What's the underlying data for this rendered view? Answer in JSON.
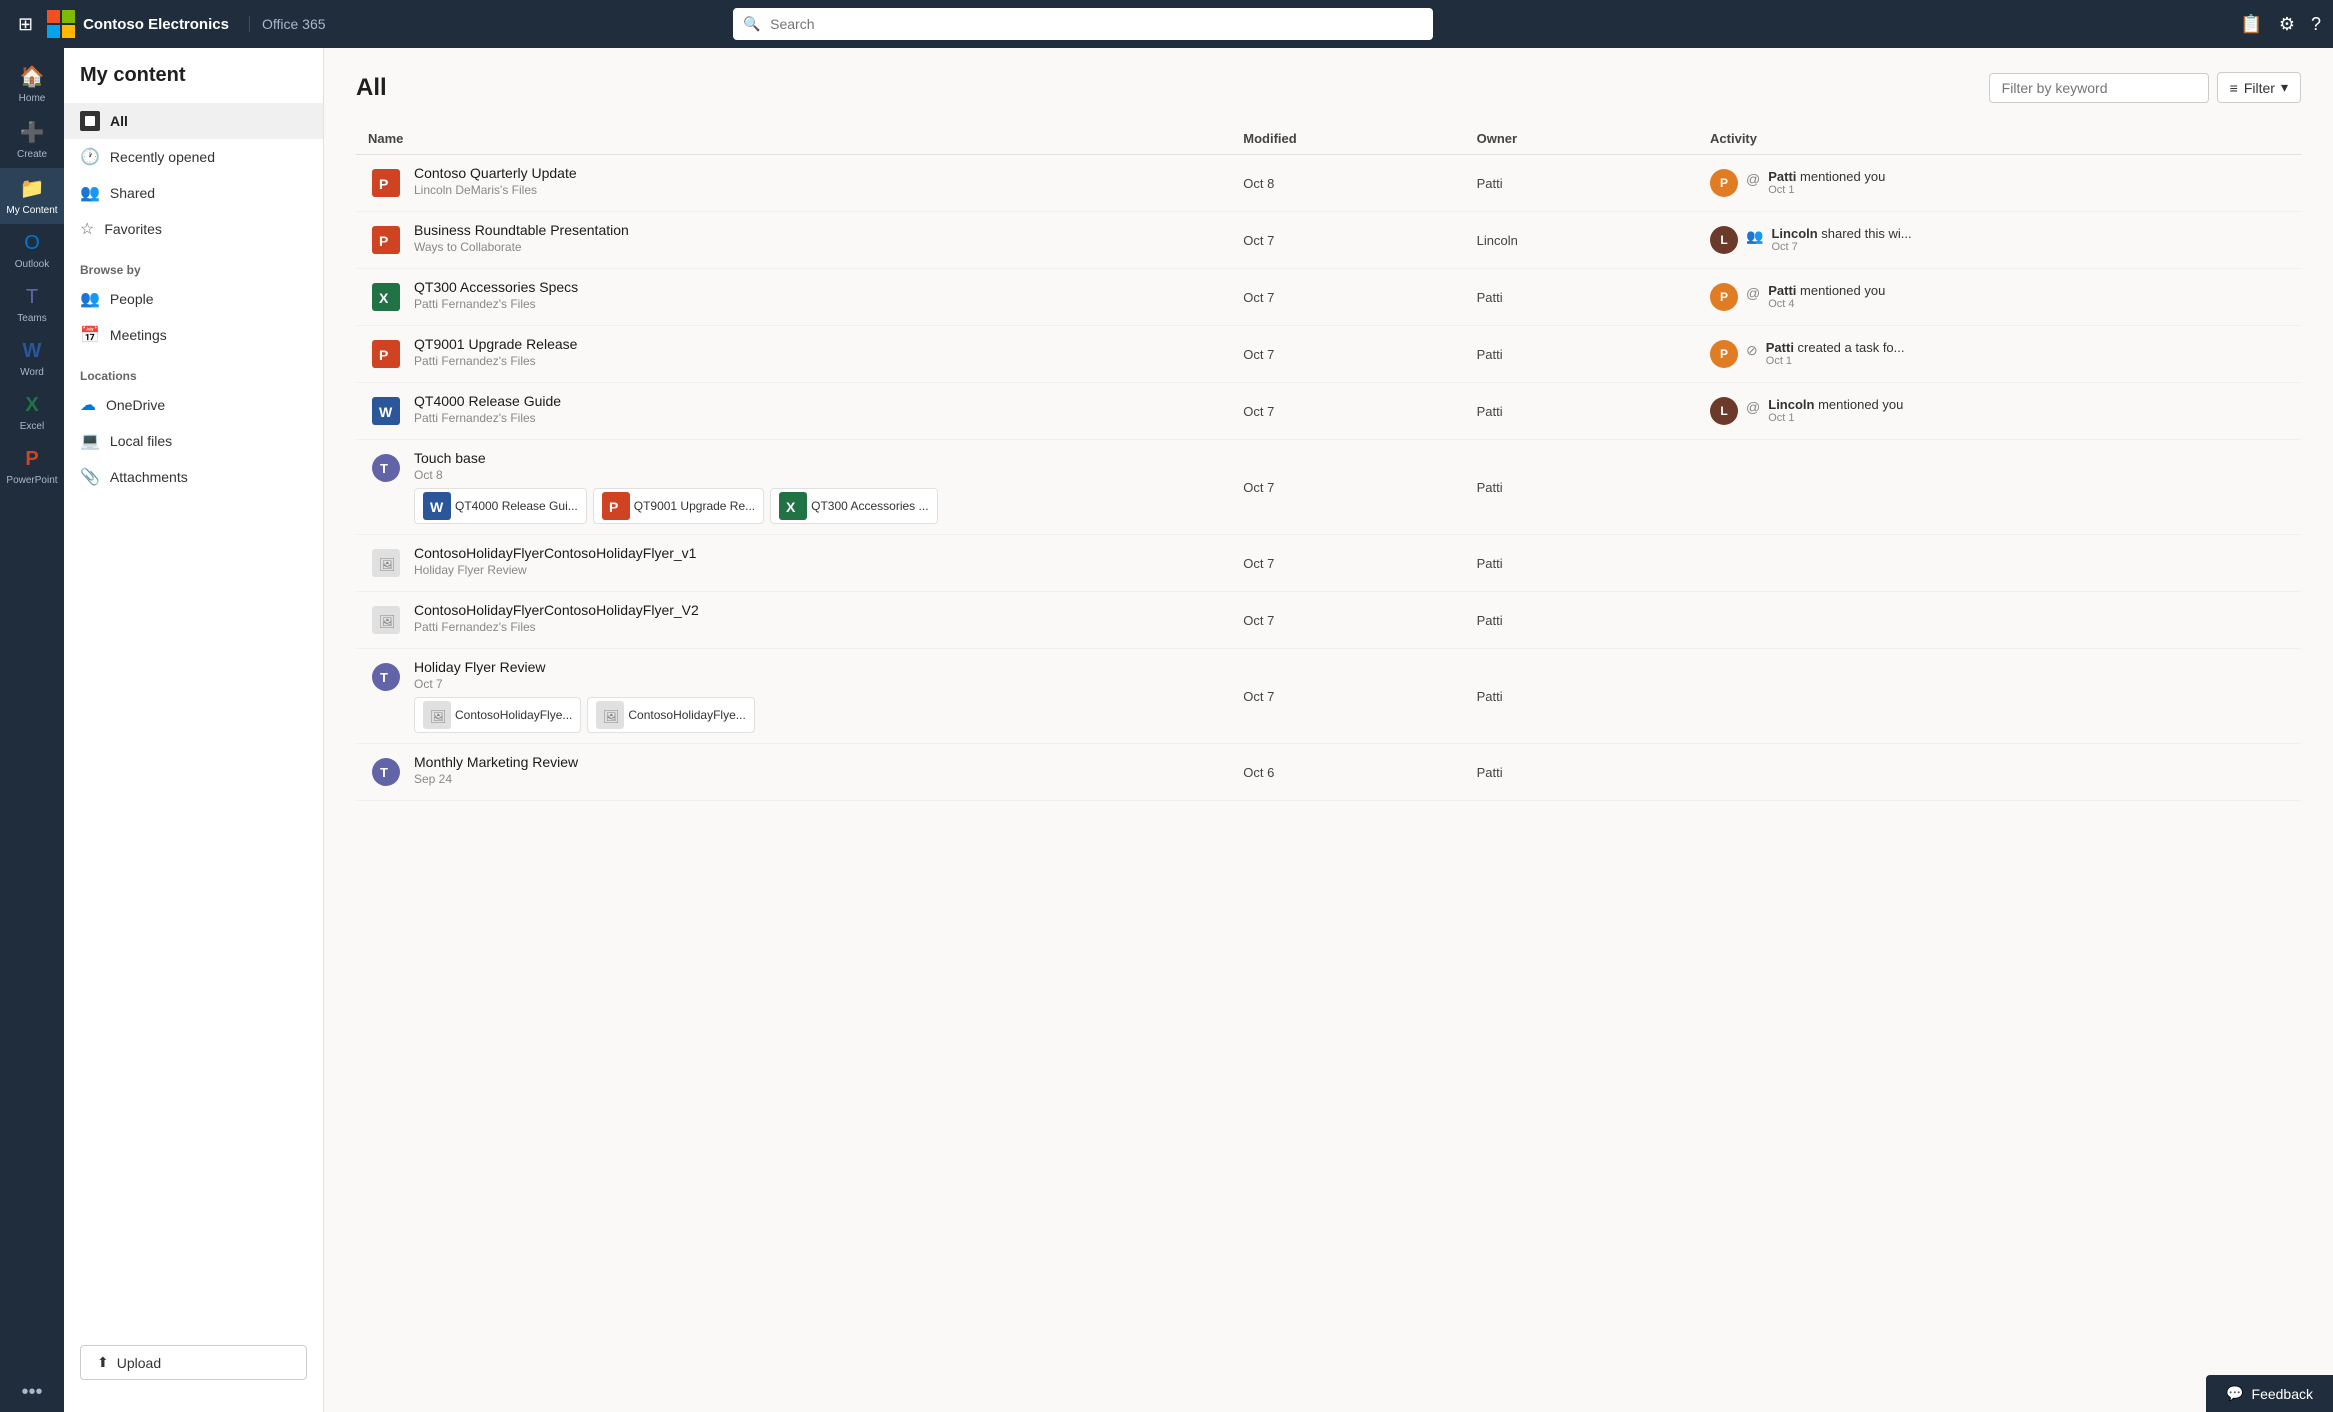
{
  "topNav": {
    "appName": "Contoso Electronics",
    "office365": "Office 365",
    "search": {
      "placeholder": "Search"
    }
  },
  "leftRail": {
    "items": [
      {
        "id": "home",
        "label": "Home",
        "icon": "🏠"
      },
      {
        "id": "create",
        "label": "Create",
        "icon": "➕"
      },
      {
        "id": "mycontent",
        "label": "My Content",
        "icon": "📁",
        "active": true
      },
      {
        "id": "outlook",
        "label": "Outlook",
        "icon": "📧",
        "color": "#0078d4"
      },
      {
        "id": "teams",
        "label": "Teams",
        "icon": "💬",
        "color": "#6264a7"
      },
      {
        "id": "word",
        "label": "Word",
        "icon": "W",
        "color": "#2b579a"
      },
      {
        "id": "excel",
        "label": "Excel",
        "icon": "X",
        "color": "#217346"
      },
      {
        "id": "powerpoint",
        "label": "PowerPoint",
        "icon": "P",
        "color": "#d04322"
      }
    ],
    "more": "..."
  },
  "sidebar": {
    "title": "My content",
    "navItems": [
      {
        "id": "all",
        "label": "All",
        "active": true,
        "type": "all"
      },
      {
        "id": "recentlyopened",
        "label": "Recently opened",
        "icon": "🕐"
      },
      {
        "id": "shared",
        "label": "Shared",
        "icon": "👥"
      },
      {
        "id": "favorites",
        "label": "Favorites",
        "icon": "☆"
      }
    ],
    "browseSectionLabel": "Browse by",
    "browseItems": [
      {
        "id": "people",
        "label": "People",
        "icon": "👥"
      },
      {
        "id": "meetings",
        "label": "Meetings",
        "icon": "📅"
      }
    ],
    "locationsSectionLabel": "Locations",
    "locationItems": [
      {
        "id": "onedrive",
        "label": "OneDrive",
        "icon": "☁"
      },
      {
        "id": "localfiles",
        "label": "Local files",
        "icon": "💻"
      },
      {
        "id": "attachments",
        "label": "Attachments",
        "icon": "📎"
      }
    ],
    "uploadLabel": "Upload"
  },
  "main": {
    "title": "All",
    "filterPlaceholder": "Filter by keyword",
    "filterLabel": "Filter",
    "columns": {
      "name": "Name",
      "modified": "Modified",
      "owner": "Owner",
      "activity": "Activity"
    },
    "files": [
      {
        "id": 1,
        "icon": "ppt",
        "title": "Contoso Quarterly Update",
        "subtitle": "Lincoln DeMaris's Files",
        "modified": "Oct 8",
        "owner": "Patti",
        "activity": {
          "avatar": "P",
          "avatarBg": "#e07c24",
          "name": "Patti",
          "action": "mentioned you",
          "actionIcon": "@",
          "date": "Oct 1"
        }
      },
      {
        "id": 2,
        "icon": "ppt",
        "title": "Business Roundtable Presentation",
        "subtitle": "Ways to Collaborate",
        "modified": "Oct 7",
        "owner": "Lincoln",
        "activity": {
          "avatar": "L",
          "avatarBg": "#6b3a2a",
          "name": "Lincoln",
          "action": "shared this wi...",
          "actionIcon": "👥",
          "date": "Oct 7"
        }
      },
      {
        "id": 3,
        "icon": "xlsx",
        "title": "QT300 Accessories Specs",
        "subtitle": "Patti Fernandez's Files",
        "modified": "Oct 7",
        "owner": "Patti",
        "activity": {
          "avatar": "P",
          "avatarBg": "#e07c24",
          "name": "Patti",
          "action": "mentioned you",
          "actionIcon": "@",
          "date": "Oct 4"
        }
      },
      {
        "id": 4,
        "icon": "ppt",
        "title": "QT9001 Upgrade Release",
        "subtitle": "Patti Fernandez's Files",
        "modified": "Oct 7",
        "owner": "Patti",
        "activity": {
          "avatar": "P",
          "avatarBg": "#e07c24",
          "name": "Patti",
          "action": "created a task fo...",
          "actionIcon": "⊘",
          "date": "Oct 1"
        }
      },
      {
        "id": 5,
        "icon": "word",
        "title": "QT4000 Release Guide",
        "subtitle": "Patti Fernandez's Files",
        "modified": "Oct 7",
        "owner": "Patti",
        "activity": {
          "avatar": "L",
          "avatarBg": "#6b3a2a",
          "name": "Lincoln",
          "action": "mentioned you",
          "actionIcon": "@",
          "date": "Oct 1"
        }
      },
      {
        "id": 6,
        "icon": "teams",
        "title": "Touch base",
        "subtitle": "Oct 8",
        "modified": "Oct 7",
        "owner": "Patti",
        "activity": null,
        "chips": [
          {
            "icon": "word",
            "label": "QT4000 Release Gui..."
          },
          {
            "icon": "ppt",
            "label": "QT9001 Upgrade Re..."
          },
          {
            "icon": "xlsx",
            "label": "QT300 Accessories ..."
          }
        ]
      },
      {
        "id": 7,
        "icon": "image",
        "title": "ContosoHolidayFlyerContosoHolidayFlyer_v1",
        "subtitle": "Holiday Flyer Review",
        "modified": "Oct 7",
        "owner": "Patti",
        "activity": null
      },
      {
        "id": 8,
        "icon": "image",
        "title": "ContosoHolidayFlyerContosoHolidayFlyer_V2",
        "subtitle": "Patti Fernandez's Files",
        "modified": "Oct 7",
        "owner": "Patti",
        "activity": null
      },
      {
        "id": 9,
        "icon": "teams",
        "title": "Holiday Flyer Review",
        "subtitle": "Oct 7",
        "modified": "Oct 7",
        "owner": "Patti",
        "activity": null,
        "chips": [
          {
            "icon": "image",
            "label": "ContosoHolidayFlye..."
          },
          {
            "icon": "image",
            "label": "ContosoHolidayFlye..."
          }
        ]
      },
      {
        "id": 10,
        "icon": "teams",
        "title": "Monthly Marketing Review",
        "subtitle": "Sep 24",
        "modified": "Oct 6",
        "owner": "Patti",
        "activity": null
      }
    ]
  },
  "feedback": {
    "label": "Feedback"
  }
}
